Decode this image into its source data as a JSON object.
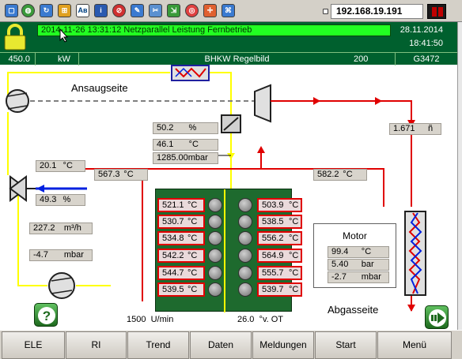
{
  "toolbar": {
    "icons": [
      "monitor-icon",
      "globe-icon",
      "refresh-icon",
      "windows-flag-icon",
      "text-abc-icon",
      "info-pin-icon",
      "no-entry-icon",
      "wrench-settings-icon",
      "tools-icon",
      "export-icon",
      "target-icon",
      "crosshair-icon",
      "network-icon"
    ],
    "ip_address": "192.168.19.191"
  },
  "header": {
    "alarm_text": "2014-11-26 13:31:12   Netzparallel Leistung Fernbetrieb",
    "date": "28.11.2014",
    "time": "18:41:50"
  },
  "status_row": {
    "power_value": "450.0",
    "power_unit": "kW",
    "title": "BHKW Regelbild",
    "code_left": "200",
    "code_right": "G3472"
  },
  "diagram": {
    "intake_label": "Ansaugseite",
    "exhaust_label": "Abgasseite",
    "throttle_percent": {
      "value": "50.2",
      "unit": "%"
    },
    "mix_temp": {
      "value": "46.1",
      "unit": "°C"
    },
    "mix_pressure": {
      "value": "1285.00mbar",
      "unit": ""
    },
    "exhaust_left": {
      "value": "567.3",
      "unit": "°C"
    },
    "exhaust_right": {
      "value": "582.2",
      "unit": "°C"
    },
    "exhaust_flow": {
      "value": "1.671",
      "unit": "ñ"
    },
    "gas_temp": {
      "value": "20.1",
      "unit": "°C"
    },
    "gas_valve": {
      "value": "49.3",
      "unit": "%"
    },
    "gas_flow": {
      "value": "227.2",
      "unit": "m³/h"
    },
    "gas_pressure": {
      "value": "-4.7",
      "unit": "mbar"
    },
    "cylinders_left": [
      {
        "value": "521.1",
        "unit": "°C"
      },
      {
        "value": "530.7",
        "unit": "°C"
      },
      {
        "value": "534.8",
        "unit": "°C"
      },
      {
        "value": "542.2",
        "unit": "°C"
      },
      {
        "value": "544.7",
        "unit": "°C"
      },
      {
        "value": "539.5",
        "unit": "°C"
      }
    ],
    "cylinders_right": [
      {
        "value": "503.9",
        "unit": "°C"
      },
      {
        "value": "538.5",
        "unit": "°C"
      },
      {
        "value": "556.2",
        "unit": "°C"
      },
      {
        "value": "564.9",
        "unit": "°C"
      },
      {
        "value": "555.7",
        "unit": "°C"
      },
      {
        "value": "539.7",
        "unit": "°C"
      }
    ],
    "rpm": {
      "value": "1500",
      "unit": "U/min"
    },
    "ignition": {
      "value": "26.0",
      "unit": "°v. OT"
    },
    "motor": {
      "title": "Motor",
      "rows": [
        {
          "value": "99.4",
          "unit": "°C"
        },
        {
          "value": "5.40",
          "unit": "bar"
        },
        {
          "value": "-2.7",
          "unit": "mbar"
        }
      ]
    }
  },
  "nav": {
    "buttons": [
      "ELE",
      "RI",
      "Trend",
      "Daten",
      "Meldungen",
      "Start",
      "Menü"
    ]
  },
  "colors": {
    "header_green": "#00602e",
    "alarm_green": "#22ff22",
    "engine_green": "#1e6a2e",
    "pipe_yellow": "#ffff00",
    "pipe_red": "#e00000",
    "pipe_blue": "#0020e0"
  }
}
